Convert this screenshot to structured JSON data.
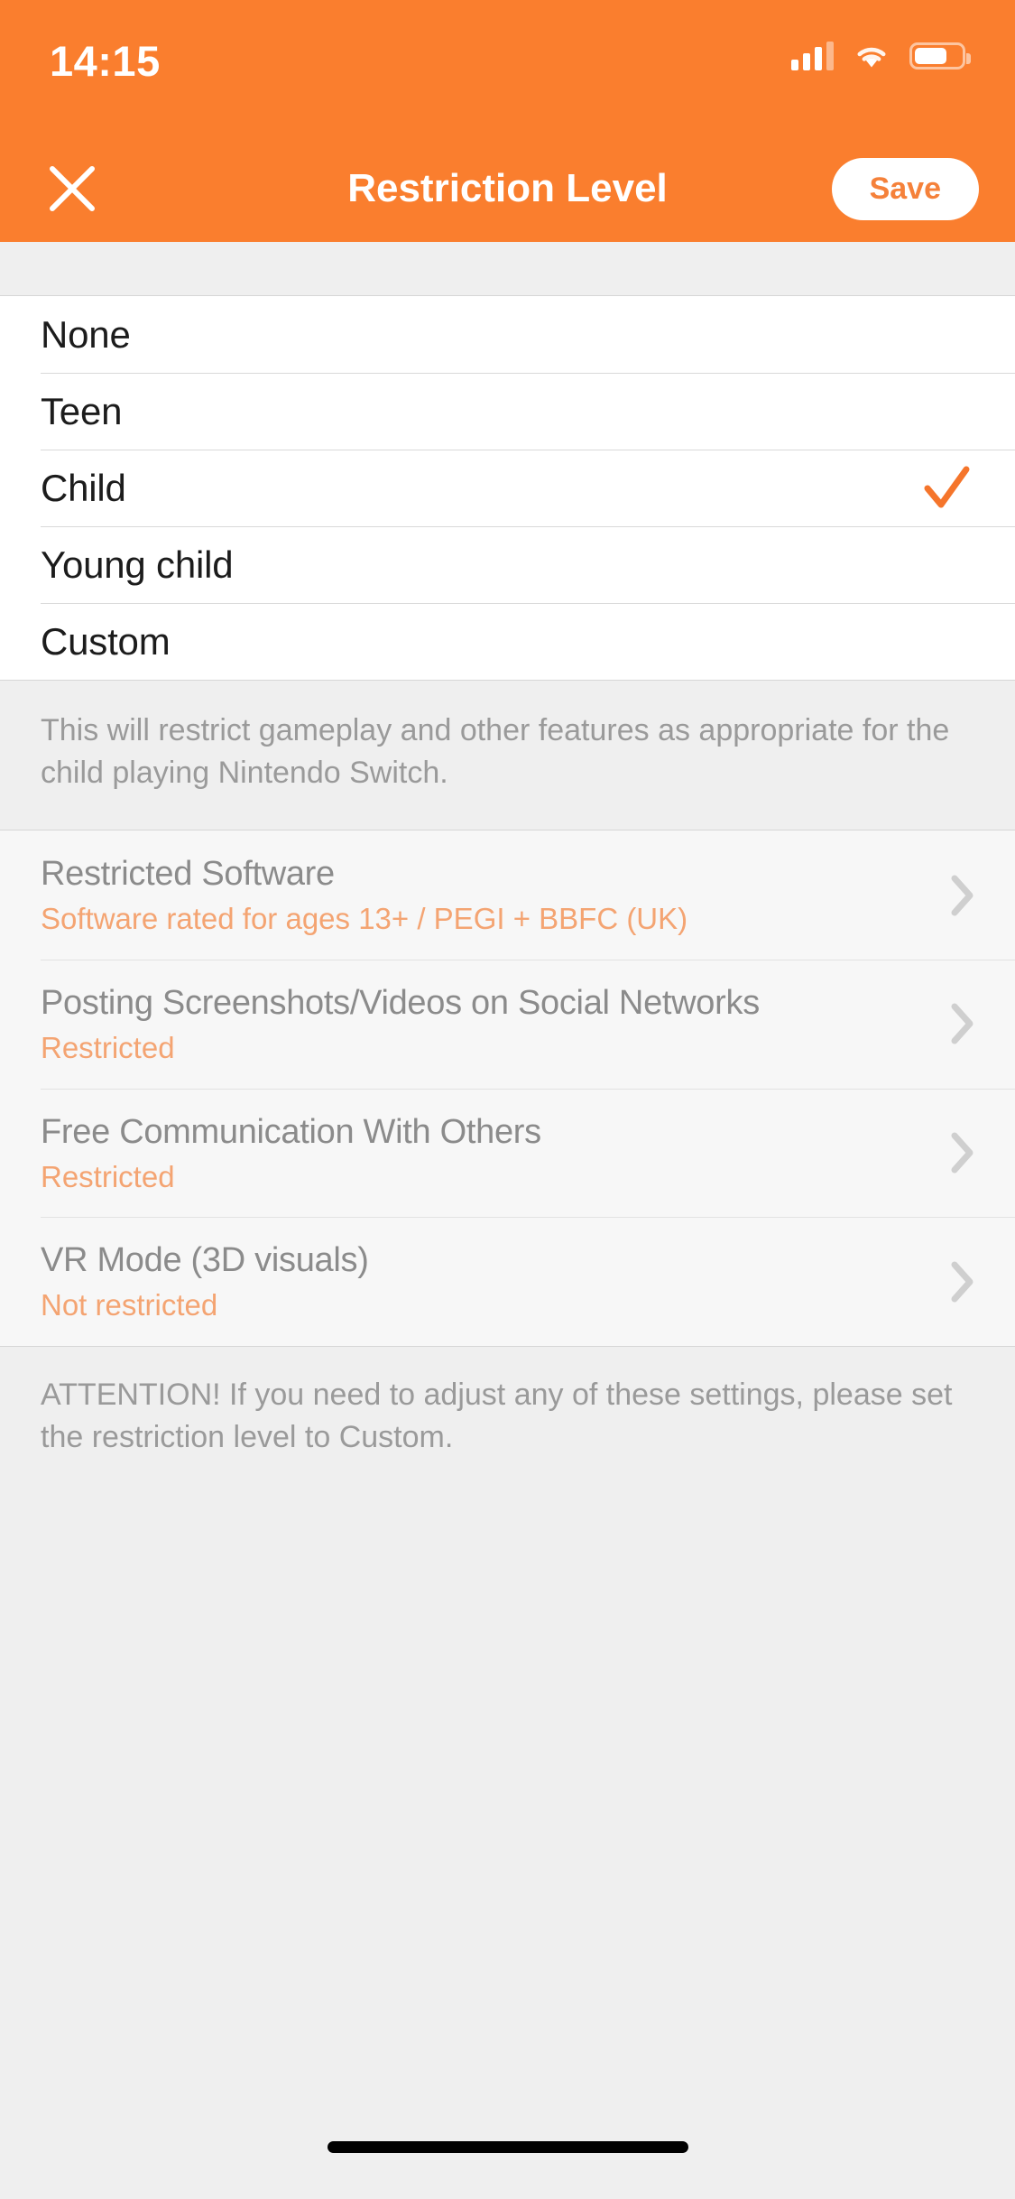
{
  "status_bar": {
    "time": "14:15",
    "signal_icon": "cellular-signal-icon",
    "wifi_icon": "wifi-icon",
    "battery_icon": "battery-icon"
  },
  "nav": {
    "close_icon": "close-icon",
    "title": "Restriction Level",
    "save_label": "Save"
  },
  "colors": {
    "accent_orange": "#FA7E2E",
    "check_orange": "#F5752B",
    "subtitle_orange": "#F4A472",
    "nav_text": "#FFFFFF",
    "body_gray": "#9A9A9A",
    "setting_title_gray": "#8B8B8B",
    "page_bg": "#EFEFEF",
    "list_bg": "#FFFFFF",
    "settings_bg": "#F7F7F7"
  },
  "restriction_levels": {
    "selected": "Child",
    "options": [
      {
        "label": "None",
        "checked": false
      },
      {
        "label": "Teen",
        "checked": false
      },
      {
        "label": "Child",
        "checked": true
      },
      {
        "label": "Young child",
        "checked": false
      },
      {
        "label": "Custom",
        "checked": false
      }
    ]
  },
  "description": "This will restrict gameplay and other features as appropriate for the child playing Nintendo Switch.",
  "settings": [
    {
      "title": "Restricted Software",
      "value": "Software rated for ages 13+ / PEGI + BBFC (UK)",
      "chevron_icon": "chevron-right-icon"
    },
    {
      "title": "Posting Screenshots/Videos on Social Networks",
      "value": "Restricted",
      "chevron_icon": "chevron-right-icon"
    },
    {
      "title": "Free Communication With Others",
      "value": "Restricted",
      "chevron_icon": "chevron-right-icon"
    },
    {
      "title": "VR Mode (3D visuals)",
      "value": "Not restricted",
      "chevron_icon": "chevron-right-icon"
    }
  ],
  "attention": "ATTENTION! If you need to adjust any of these settings, please set the restriction level to Custom."
}
